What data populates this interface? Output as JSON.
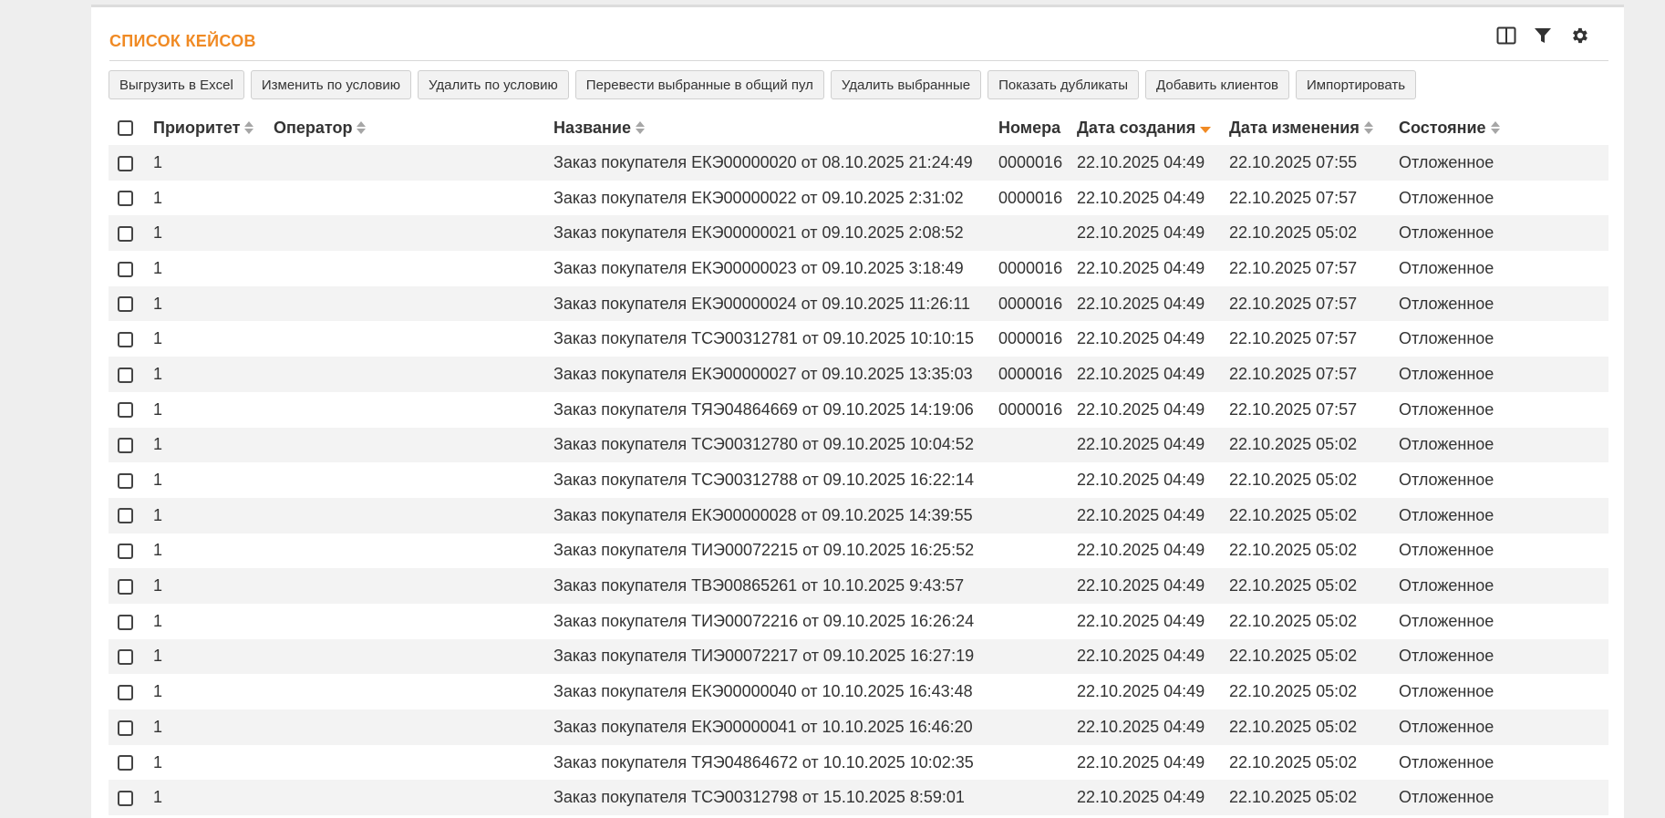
{
  "title": "СПИСОК КЕЙСОВ",
  "icons": [
    "columns-icon",
    "filter-icon",
    "settings-gear-icon"
  ],
  "toolbar": {
    "buttons": [
      "Выгрузить в Excel",
      "Изменить по условию",
      "Удалить по условию",
      "Перевести выбранные в общий пул",
      "Удалить выбранные",
      "Показать дубликаты",
      "Добавить клиентов",
      "Импортировать"
    ]
  },
  "table": {
    "columns": [
      "Приоритет",
      "Оператор",
      "Название",
      "Номера",
      "Дата создания",
      "Дата изменения",
      "Состояние"
    ],
    "sorted_column": "Дата создания",
    "sort_direction": "desc",
    "accent_color": "#f08a24",
    "rows": [
      {
        "priority": "1",
        "operator": "",
        "name": "Заказ покупателя ЕКЭ00000020 от 08.10.2025 21:24:49",
        "number": "0000016",
        "created": "22.10.2025 04:49",
        "modified": "22.10.2025 07:55",
        "state": "Отложенное"
      },
      {
        "priority": "1",
        "operator": "",
        "name": "Заказ покупателя ЕКЭ00000022 от 09.10.2025 2:31:02",
        "number": "0000016",
        "created": "22.10.2025 04:49",
        "modified": "22.10.2025 07:57",
        "state": "Отложенное"
      },
      {
        "priority": "1",
        "operator": "",
        "name": "Заказ покупателя ЕКЭ00000021 от 09.10.2025 2:08:52",
        "number": "",
        "created": "22.10.2025 04:49",
        "modified": "22.10.2025 05:02",
        "state": "Отложенное"
      },
      {
        "priority": "1",
        "operator": "",
        "name": "Заказ покупателя ЕКЭ00000023 от 09.10.2025 3:18:49",
        "number": "0000016",
        "created": "22.10.2025 04:49",
        "modified": "22.10.2025 07:57",
        "state": "Отложенное"
      },
      {
        "priority": "1",
        "operator": "",
        "name": "Заказ покупателя ЕКЭ00000024 от 09.10.2025 11:26:11",
        "number": "0000016",
        "created": "22.10.2025 04:49",
        "modified": "22.10.2025 07:57",
        "state": "Отложенное"
      },
      {
        "priority": "1",
        "operator": "",
        "name": "Заказ покупателя ТСЭ00312781 от 09.10.2025 10:10:15",
        "number": "0000016",
        "created": "22.10.2025 04:49",
        "modified": "22.10.2025 07:57",
        "state": "Отложенное"
      },
      {
        "priority": "1",
        "operator": "",
        "name": "Заказ покупателя ЕКЭ00000027 от 09.10.2025 13:35:03",
        "number": "0000016",
        "created": "22.10.2025 04:49",
        "modified": "22.10.2025 07:57",
        "state": "Отложенное"
      },
      {
        "priority": "1",
        "operator": "",
        "name": "Заказ покупателя ТЯЭ04864669 от 09.10.2025 14:19:06",
        "number": "0000016",
        "created": "22.10.2025 04:49",
        "modified": "22.10.2025 07:57",
        "state": "Отложенное"
      },
      {
        "priority": "1",
        "operator": "",
        "name": "Заказ покупателя ТСЭ00312780 от 09.10.2025 10:04:52",
        "number": "",
        "created": "22.10.2025 04:49",
        "modified": "22.10.2025 05:02",
        "state": "Отложенное"
      },
      {
        "priority": "1",
        "operator": "",
        "name": "Заказ покупателя ТСЭ00312788 от 09.10.2025 16:22:14",
        "number": "",
        "created": "22.10.2025 04:49",
        "modified": "22.10.2025 05:02",
        "state": "Отложенное"
      },
      {
        "priority": "1",
        "operator": "",
        "name": "Заказ покупателя ЕКЭ00000028 от 09.10.2025 14:39:55",
        "number": "",
        "created": "22.10.2025 04:49",
        "modified": "22.10.2025 05:02",
        "state": "Отложенное"
      },
      {
        "priority": "1",
        "operator": "",
        "name": "Заказ покупателя ТИЭ00072215 от 09.10.2025 16:25:52",
        "number": "",
        "created": "22.10.2025 04:49",
        "modified": "22.10.2025 05:02",
        "state": "Отложенное"
      },
      {
        "priority": "1",
        "operator": "",
        "name": "Заказ покупателя ТВЭ00865261 от 10.10.2025 9:43:57",
        "number": "",
        "created": "22.10.2025 04:49",
        "modified": "22.10.2025 05:02",
        "state": "Отложенное"
      },
      {
        "priority": "1",
        "operator": "",
        "name": "Заказ покупателя ТИЭ00072216 от 09.10.2025 16:26:24",
        "number": "",
        "created": "22.10.2025 04:49",
        "modified": "22.10.2025 05:02",
        "state": "Отложенное"
      },
      {
        "priority": "1",
        "operator": "",
        "name": "Заказ покупателя ТИЭ00072217 от 09.10.2025 16:27:19",
        "number": "",
        "created": "22.10.2025 04:49",
        "modified": "22.10.2025 05:02",
        "state": "Отложенное"
      },
      {
        "priority": "1",
        "operator": "",
        "name": "Заказ покупателя ЕКЭ00000040 от 10.10.2025 16:43:48",
        "number": "",
        "created": "22.10.2025 04:49",
        "modified": "22.10.2025 05:02",
        "state": "Отложенное"
      },
      {
        "priority": "1",
        "operator": "",
        "name": "Заказ покупателя ЕКЭ00000041 от 10.10.2025 16:46:20",
        "number": "",
        "created": "22.10.2025 04:49",
        "modified": "22.10.2025 05:02",
        "state": "Отложенное"
      },
      {
        "priority": "1",
        "operator": "",
        "name": "Заказ покупателя ТЯЭ04864672 от 10.10.2025 10:02:35",
        "number": "",
        "created": "22.10.2025 04:49",
        "modified": "22.10.2025 05:02",
        "state": "Отложенное"
      },
      {
        "priority": "1",
        "operator": "",
        "name": "Заказ покупателя ТСЭ00312798 от 15.10.2025 8:59:01",
        "number": "",
        "created": "22.10.2025 04:49",
        "modified": "22.10.2025 05:02",
        "state": "Отложенное"
      }
    ]
  }
}
